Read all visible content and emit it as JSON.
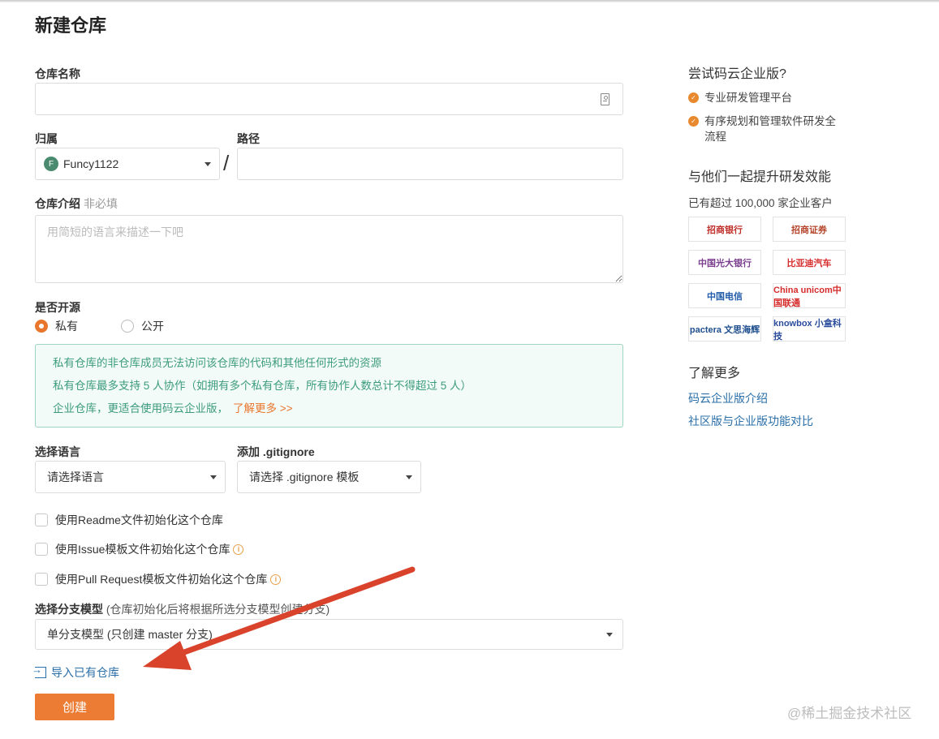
{
  "page": {
    "title": "新建仓库"
  },
  "form": {
    "repo_name": {
      "label": "仓库名称",
      "value": "",
      "placeholder": ""
    },
    "owner": {
      "label": "归属",
      "avatar_letter": "F",
      "value": "Funcy1122"
    },
    "path": {
      "label": "路径",
      "value": ""
    },
    "description": {
      "label": "仓库介绍",
      "optional": "非必填",
      "placeholder": "用简短的语言来描述一下吧"
    },
    "visibility": {
      "label": "是否开源",
      "options": [
        {
          "label": "私有",
          "checked": true
        },
        {
          "label": "公开",
          "checked": false
        }
      ]
    },
    "notice": {
      "lines": [
        "私有仓库的非仓库成员无法访问该仓库的代码和其他任何形式的资源",
        "私有仓库最多支持 5 人协作（如拥有多个私有仓库，所有协作人数总计不得超过 5 人）",
        "企业仓库，更适合使用码云企业版，"
      ],
      "link": "了解更多 >>"
    },
    "language": {
      "label": "选择语言",
      "value": "请选择语言"
    },
    "gitignore": {
      "label": "添加 .gitignore",
      "value": "请选择 .gitignore 模板"
    },
    "checkboxes": [
      {
        "label": "使用Readme文件初始化这个仓库",
        "info": false
      },
      {
        "label": "使用Issue模板文件初始化这个仓库",
        "info": true
      },
      {
        "label": "使用Pull Request模板文件初始化这个仓库",
        "info": true
      }
    ],
    "branch_model": {
      "label": "选择分支模型",
      "hint": "(仓库初始化后将根据所选分支模型创建分支)",
      "value": "单分支模型 (只创建 master 分支)"
    },
    "import_link": "导入已有仓库",
    "create_button": "创建"
  },
  "sidebar": {
    "enterprise_title": "尝试码云企业版?",
    "features": [
      "专业研发管理平台",
      "有序规划和管理软件研发全流程"
    ],
    "together_title": "与他们一起提升研发效能",
    "customers_text": "已有超过 100,000 家企业客户",
    "logos": [
      {
        "text": "招商银行",
        "color": "#c0302b"
      },
      {
        "text": "招商证券",
        "color": "#b5462d"
      },
      {
        "text": "中国光大银行",
        "color": "#7a3d8e"
      },
      {
        "text": "比亚迪汽车",
        "color": "#d62b2b"
      },
      {
        "text": "中国电信",
        "color": "#1f5ba8"
      },
      {
        "text": "China unicom中国联通",
        "color": "#d62b2b"
      },
      {
        "text": "pactera 文思海辉",
        "color": "#1f4f8e"
      },
      {
        "text": "knowbox 小盒科技",
        "color": "#2a4c9c"
      }
    ],
    "learn_more_title": "了解更多",
    "links": [
      "码云企业版介绍",
      "社区版与企业版功能对比"
    ]
  },
  "watermark": "@稀土掘金技术社区",
  "colors": {
    "accent": "#ec7c33",
    "link": "#2a6fa8",
    "notice_text": "#3c9b7d",
    "annotation_arrow": "#d9432c"
  }
}
